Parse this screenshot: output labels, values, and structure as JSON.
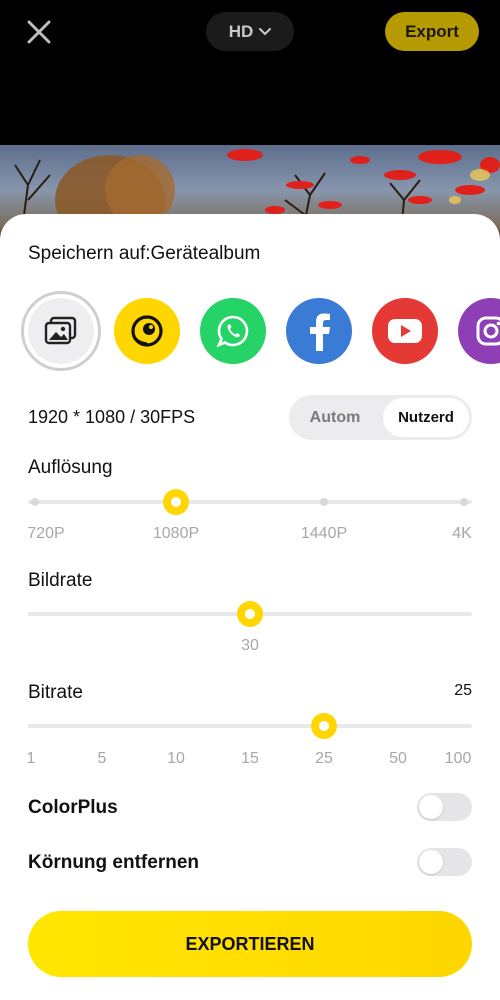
{
  "header": {
    "quality_label": "HD",
    "export_label": "Export"
  },
  "save": {
    "label": "Speichern auf:Gerätealbum"
  },
  "share_targets": [
    "gallery-icon",
    "snapchat-like-icon",
    "whatsapp-icon",
    "facebook-icon",
    "youtube-icon",
    "instagram-icon"
  ],
  "resolution_summary": "1920 * 1080 / 30FPS",
  "mode": {
    "auto_label": "Autom",
    "user_label": "Nutzerd",
    "selected": "Nutzerd"
  },
  "resolution": {
    "title": "Auflösung",
    "ticks": [
      "720P",
      "1080P",
      "1440P",
      "4K"
    ],
    "selected": "1080P"
  },
  "framerate": {
    "title": "Bildrate",
    "value": "30"
  },
  "bitrate": {
    "title": "Bitrate",
    "value": "25",
    "ticks": [
      "1",
      "5",
      "10",
      "15",
      "25",
      "50",
      "100"
    ],
    "selected": "25"
  },
  "toggles": {
    "colorplus": {
      "label": "ColorPlus",
      "on": false
    },
    "grain": {
      "label": "Körnung entfernen",
      "on": false
    }
  },
  "export_button": "EXPORTIEREN",
  "colors": {
    "accent": "#FFD600",
    "export_top": "#B59A00",
    "whatsapp": "#25D366",
    "facebook": "#3A7BD5",
    "youtube": "#E53935",
    "instagram": "#8E3FB5"
  }
}
